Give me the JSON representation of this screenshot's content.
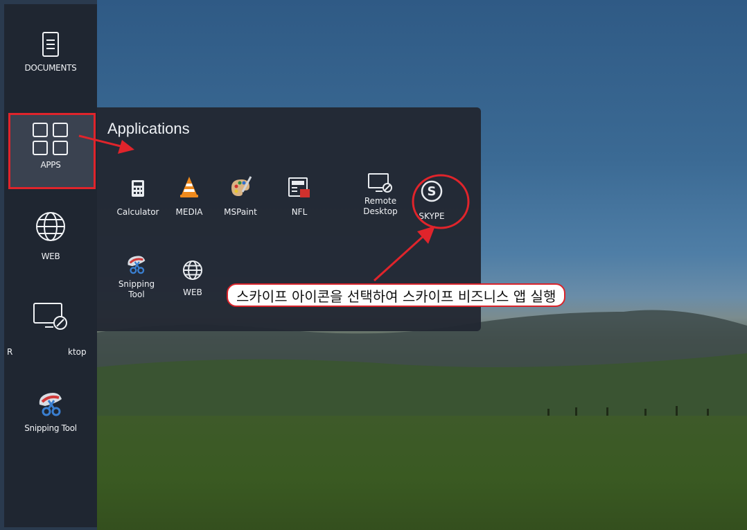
{
  "sidebar": {
    "items": [
      {
        "label": "DOCUMENTS",
        "icon": "document-icon"
      },
      {
        "label": "APPS",
        "icon": "apps-grid-icon"
      },
      {
        "label": "WEB",
        "icon": "globe-icon"
      },
      {
        "label": "R",
        "label2": "ktop",
        "icon": "remote-desktop-icon"
      },
      {
        "label": "Snipping Tool",
        "icon": "snipping-tool-icon"
      }
    ]
  },
  "panel": {
    "title": "Applications",
    "apps": [
      {
        "label": "Calculator",
        "icon": "calculator-icon"
      },
      {
        "label": "MEDIA",
        "icon": "vlc-cone-icon"
      },
      {
        "label": "MSPaint",
        "icon": "paint-palette-icon"
      },
      {
        "label": "NFL",
        "icon": "nfl-icon"
      },
      {
        "label": "Remote Desktop",
        "label_line1": "Remote",
        "label_line2": "Desktop",
        "icon": "remote-desktop-icon"
      },
      {
        "label": "SKYPE",
        "icon": "skype-icon"
      },
      {
        "label": "Snipping Tool",
        "label_line1": "Snipping",
        "label_line2": "Tool",
        "icon": "snipping-tool-icon"
      },
      {
        "label": "WEB",
        "icon": "globe-icon"
      }
    ]
  },
  "annotation": {
    "text": "스카이프 아이콘을 선택하여 스카이프 비즈니스 앱 실행"
  },
  "colors": {
    "sidebar_bg": "#1f2631",
    "panel_bg": "#222832",
    "highlight_red": "#e0242b",
    "text": "#f1f3f6"
  }
}
